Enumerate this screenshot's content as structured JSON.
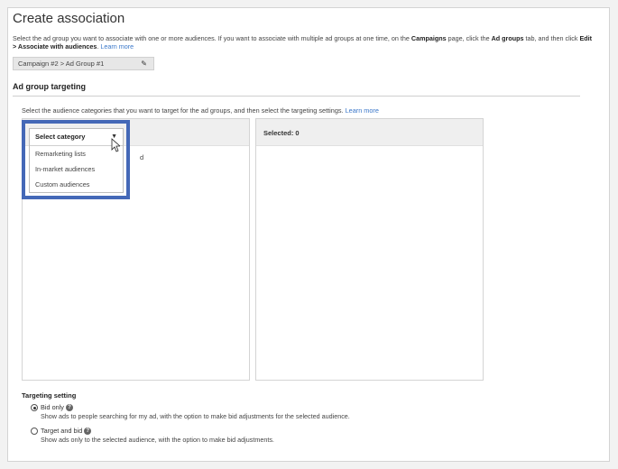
{
  "title": "Create association",
  "description": {
    "part1": "Select the ad group you want to associate with one or more audiences. If you want to associate with multiple ad groups at one time, on the ",
    "campaigns": "Campaigns",
    "part2": " page, click the ",
    "ad_groups": "Ad groups",
    "part3": " tab, and then click ",
    "edit_assoc": "Edit > Associate with audiences",
    "part4": ". ",
    "learn_more": "Learn more"
  },
  "breadcrumb": "Campaign #2 > Ad Group #1",
  "section_title": "Ad group targeting",
  "instruction": {
    "text": "Select the audience categories that you want to target for the ad groups, and then select the targeting settings. ",
    "learn_more": "Learn more"
  },
  "category_dropdown": {
    "selected": "Select category",
    "options": [
      "Remarketing lists",
      "In-market audiences",
      "Custom audiences"
    ]
  },
  "left_panel_partial_text": "d",
  "selected_label": "Selected: 0",
  "targeting_setting": {
    "title": "Targeting setting",
    "options": [
      {
        "label": "Bid only",
        "desc": "Show ads to people searching for my ad, with the option to make bid adjustments for the selected audience.",
        "selected": true
      },
      {
        "label": "Target and bid",
        "desc": "Show ads only to the selected audience, with the option to make bid adjustments.",
        "selected": false
      }
    ]
  },
  "colors": {
    "highlight": "#4468b7",
    "link": "#3a77c9"
  }
}
